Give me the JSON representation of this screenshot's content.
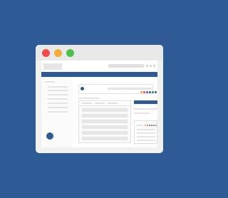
{
  "window": {
    "controls": [
      "close",
      "minimize",
      "maximize"
    ]
  },
  "colors": {
    "background": "#2e5b96",
    "accent": "#2d5a96",
    "close": "#f44a4a",
    "minimize": "#f6ad34",
    "maximize": "#4cc04d"
  },
  "card": {
    "swatches": [
      "#f4a13a",
      "#e84d4d",
      "#8e44ad",
      "#2d5a96",
      "#2d8a4a",
      "#2d5a96"
    ]
  },
  "mini_panel": {
    "swatches": [
      "#f4a13a",
      "#e84d4d",
      "#8e44ad",
      "#2d5a96",
      "#2d8a4a",
      "#888888"
    ]
  }
}
